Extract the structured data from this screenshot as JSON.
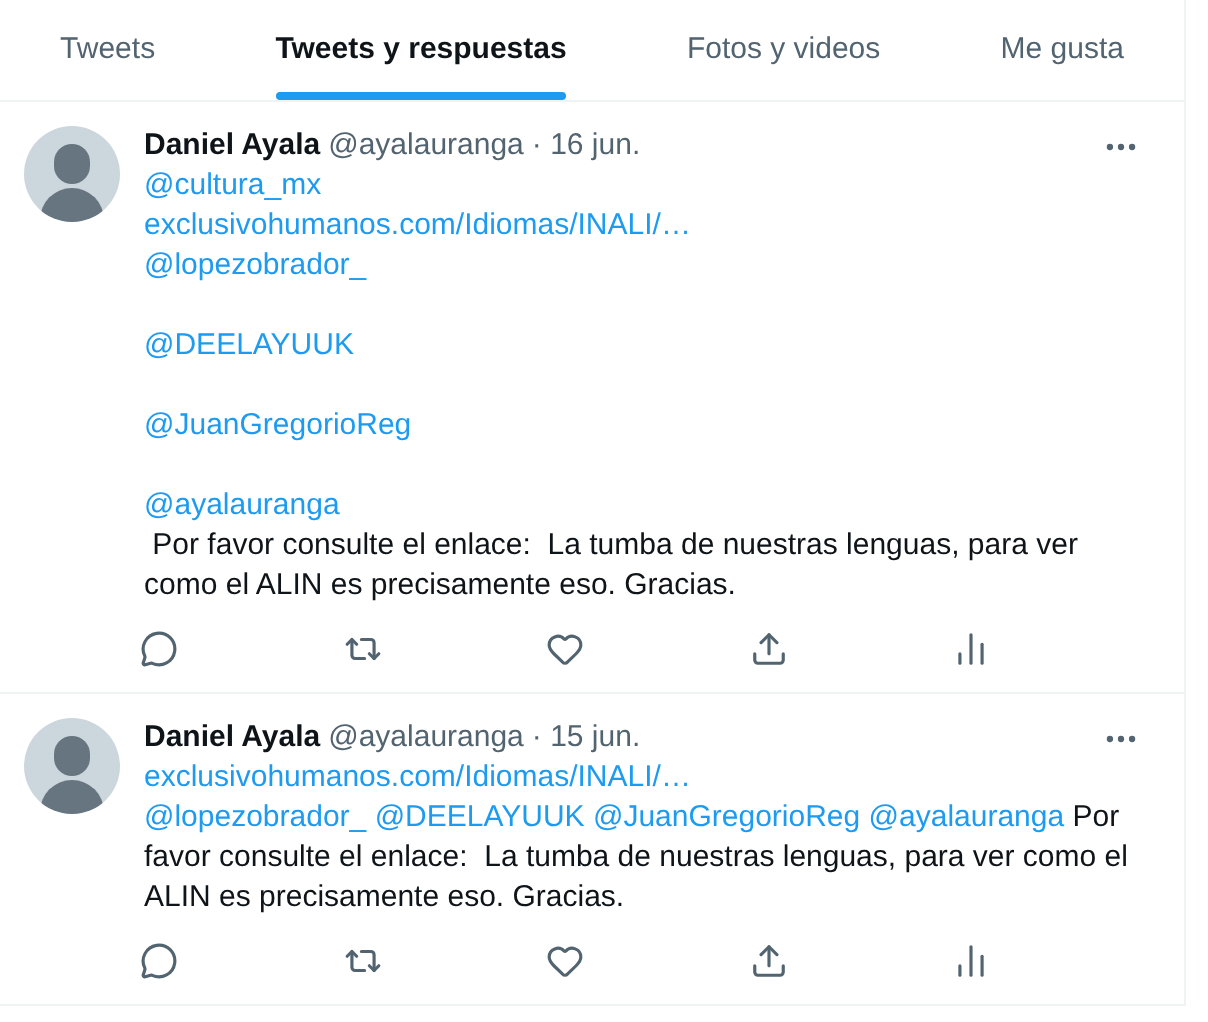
{
  "tabs": [
    {
      "label": "Tweets",
      "selected": false
    },
    {
      "label": "Tweets y respuestas",
      "selected": true
    },
    {
      "label": "Fotos y videos",
      "selected": false
    },
    {
      "label": "Me gusta",
      "selected": false
    }
  ],
  "tweets": [
    {
      "name": "Daniel Ayala",
      "handle": "@ayalauranga",
      "date": "· 16 jun.",
      "lines": [
        {
          "kind": "line",
          "segments": [
            {
              "kind": "link",
              "text": "@cultura_mx"
            }
          ]
        },
        {
          "kind": "line",
          "segments": [
            {
              "kind": "link",
              "text": "exclusivohumanos.com/Idiomas/INALI/…"
            }
          ]
        },
        {
          "kind": "line",
          "segments": [
            {
              "kind": "link",
              "text": "@lopezobrador_"
            }
          ]
        },
        {
          "kind": "blank"
        },
        {
          "kind": "line",
          "segments": [
            {
              "kind": "link",
              "text": "@DEELAYUUK"
            }
          ]
        },
        {
          "kind": "blank"
        },
        {
          "kind": "line",
          "segments": [
            {
              "kind": "link",
              "text": "@JuanGregorioReg"
            }
          ]
        },
        {
          "kind": "blank"
        },
        {
          "kind": "line",
          "segments": [
            {
              "kind": "link",
              "text": "@ayalauranga"
            }
          ]
        },
        {
          "kind": "line",
          "segments": [
            {
              "kind": "text",
              "text": " Por favor consulte el enlace:  La tumba de nuestras lenguas, para ver como el ALIN es precisamente eso. Gracias."
            }
          ]
        }
      ]
    },
    {
      "name": "Daniel Ayala",
      "handle": "@ayalauranga",
      "date": "· 15 jun.",
      "lines": [
        {
          "kind": "line",
          "segments": [
            {
              "kind": "link",
              "text": "exclusivohumanos.com/Idiomas/INALI/…"
            }
          ]
        },
        {
          "kind": "line",
          "segments": [
            {
              "kind": "link",
              "text": "@lopezobrador_"
            },
            {
              "kind": "link",
              "text": "@DEELAYUUK"
            },
            {
              "kind": "link",
              "text": "@JuanGregorioReg"
            },
            {
              "kind": "link",
              "text": "@ayalauranga"
            },
            {
              "kind": "text",
              "text": "Por favor consulte el enlace:  La tumba de nuestras lenguas, para ver como el ALIN es precisamente eso. Gracias."
            }
          ]
        }
      ]
    }
  ]
}
